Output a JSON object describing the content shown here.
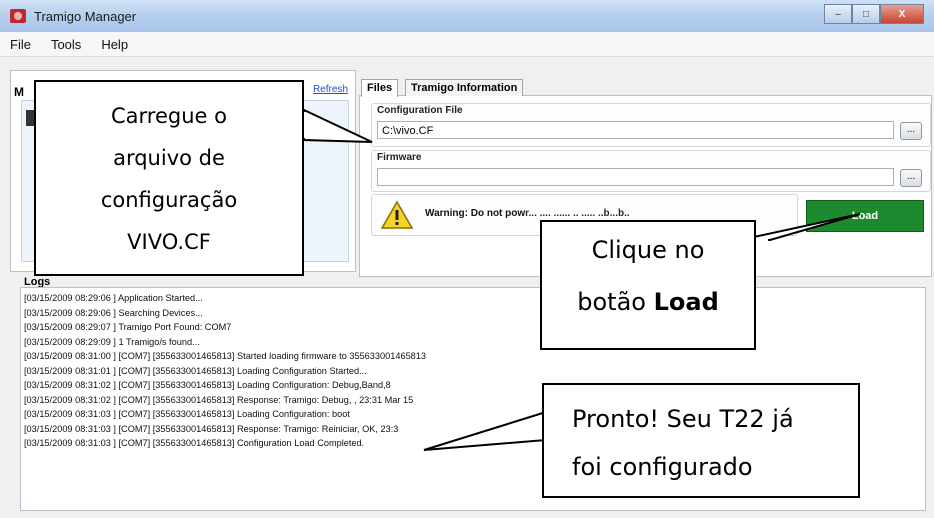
{
  "window": {
    "title": "Tramigo Manager",
    "minimize": "–",
    "maximize": "□",
    "close": "X"
  },
  "menu": [
    "File",
    "Tools",
    "Help"
  ],
  "devices": {
    "label": "M",
    "refresh": "Refresh"
  },
  "tabs": [
    "Files",
    "Tramigo Information"
  ],
  "files": {
    "config_title": "Configuration File",
    "config_value": "C:\\vivo.CF",
    "firmware_title": "Firmware",
    "firmware_value": "",
    "browse_label": "..."
  },
  "warning": {
    "text": "Warning: Do not pow",
    "text_tail": "r... .... ...... .. ..... ..b...b..",
    "icon": "warning-icon"
  },
  "load_button": "Load",
  "logs": {
    "label": "Logs",
    "lines": [
      "[03/15/2009 08:29:06 ] Application Started...",
      "[03/15/2009 08:29:06 ] Searching Devices...",
      "[03/15/2009 08:29:07 ] Tramigo Port Found: COM7",
      "[03/15/2009 08:29:09 ] 1 Tramigo/s found...",
      "[03/15/2009 08:31:00 ] [COM7] [355633001465813]  Started loading firmware  to 355633001465813",
      "[03/15/2009 08:31:01 ] [COM7] [355633001465813]  Loading Configuration Started...",
      "[03/15/2009 08:31:02 ] [COM7] [355633001465813]  Loading Configuration: Debug,Band,8",
      "[03/15/2009 08:31:02 ] [COM7] [355633001465813]  Response: Tramigo: Debug, , 23:31 Mar 15",
      "[03/15/2009 08:31:03 ] [COM7] [355633001465813]  Loading Configuration: boot",
      "[03/15/2009 08:31:03 ] [COM7] [355633001465813]  Response: Tramigo: Reiniciar, OK, 23:3",
      "[03/15/2009 08:31:03 ] [COM7] [355633001465813]  Configuration Load Completed."
    ]
  },
  "callouts": {
    "one": [
      "Carregue o",
      "arquivo de",
      "configuração",
      "VIVO.CF"
    ],
    "two_line1": "Clique no",
    "two_line2_prefix": "botão ",
    "two_line2_bold": "Load",
    "three": [
      "Pronto! Seu T22 já",
      "foi configurado"
    ]
  }
}
